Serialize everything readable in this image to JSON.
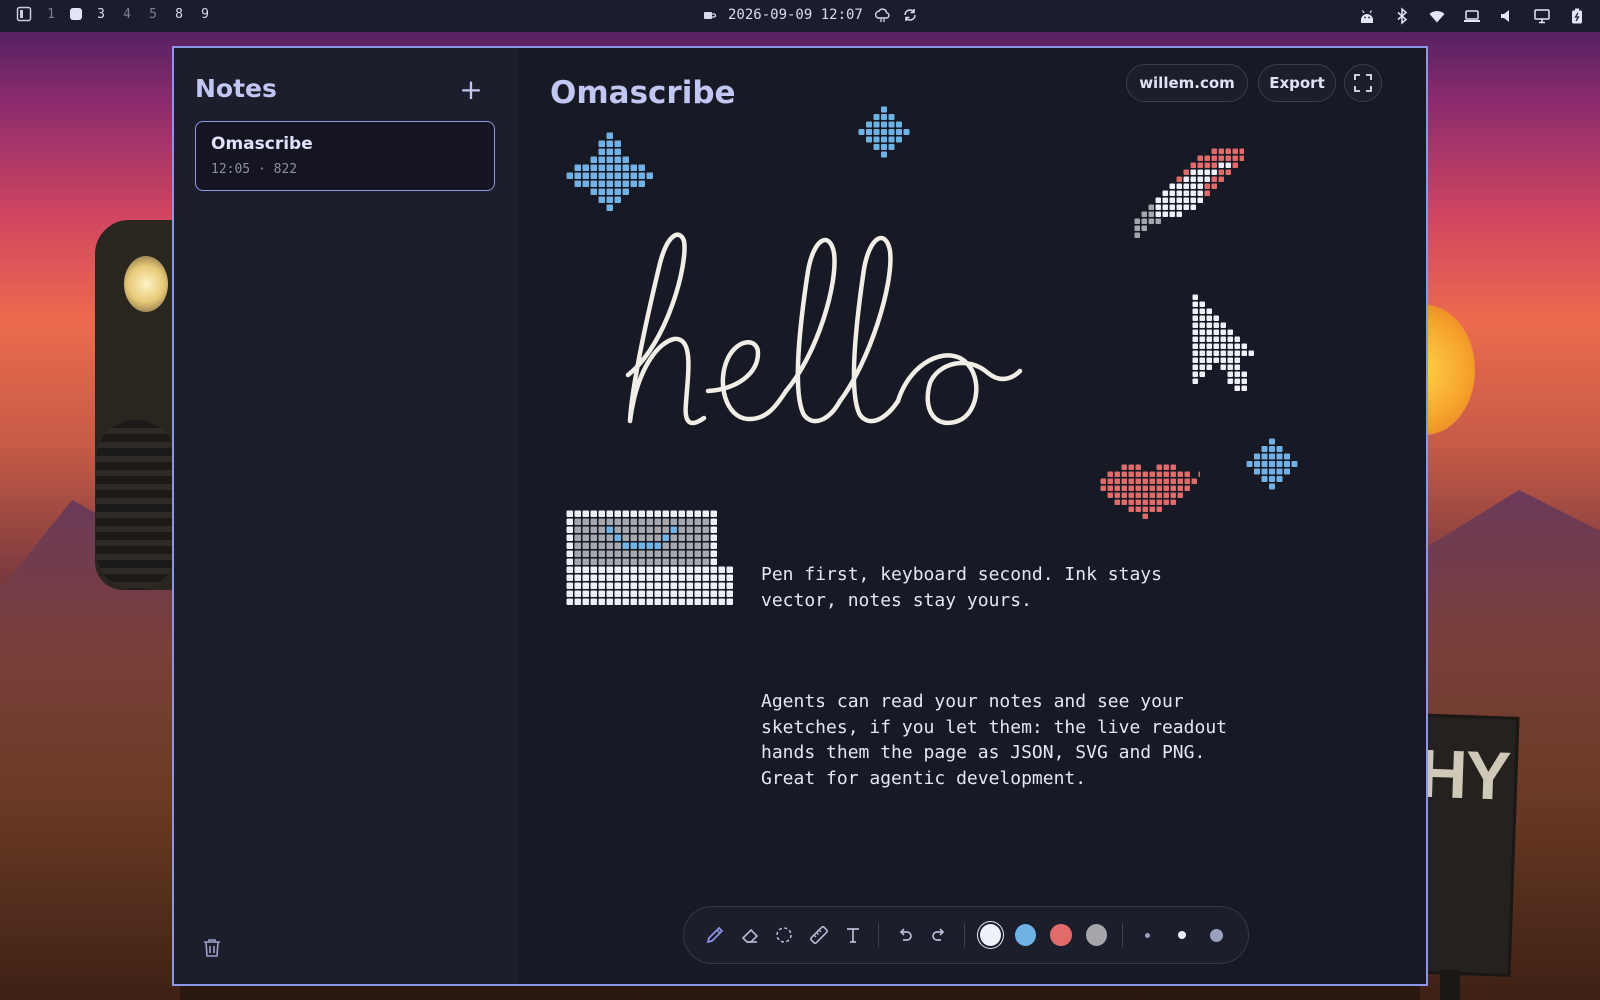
{
  "topbar": {
    "workspaces": [
      "1",
      "3",
      "4",
      "5",
      "8",
      "9"
    ],
    "datetime": "2026-09-09 12:07",
    "icons_right": [
      "android-icon",
      "bluetooth-icon",
      "wifi-icon",
      "laptop-icon",
      "volume-icon",
      "monitor-icon",
      "battery-icon"
    ]
  },
  "sidebar": {
    "title": "Notes",
    "add_label": "+",
    "notes": [
      {
        "title": "Omascribe",
        "time": "12:05",
        "separator": "·",
        "count": "822"
      }
    ]
  },
  "document": {
    "title": "Omascribe",
    "link_label": "willem.com",
    "export_label": "Export",
    "ink_text": "hello",
    "paragraph_1": "Pen first, keyboard second. Ink stays vector, notes stay yours.",
    "paragraph_2": "Agents can read your notes and see your sketches, if you let them: the live readout hands them the page as JSON, SVG and PNG. Great for agentic development."
  },
  "toolbar": {
    "tools": [
      "pen-tool",
      "eraser-tool",
      "lasso-tool",
      "ruler-tool",
      "text-tool"
    ],
    "colors": [
      "#eef0fa",
      "#6eb2e6",
      "#e06b6b",
      "#a6a6ad"
    ],
    "active_color": 0,
    "active_tool": 0
  },
  "theme": {
    "accent": "#8c95e6",
    "pixel_blue": "#6eb2e6",
    "pixel_red": "#e06b6b",
    "pixel_white": "#eef0fa",
    "pixel_gray": "#a6a6ad"
  }
}
